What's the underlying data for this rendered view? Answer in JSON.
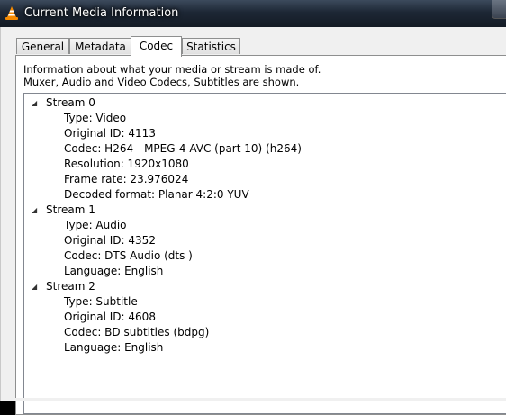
{
  "window": {
    "title": "Current Media Information",
    "icon": "vlc-cone-icon"
  },
  "tabs": [
    {
      "label": "General"
    },
    {
      "label": "Metadata"
    },
    {
      "label": "Codec",
      "active": true
    },
    {
      "label": "Statistics"
    }
  ],
  "description": {
    "line1": "Information about what your media or stream is made of.",
    "line2": "Muxer, Audio and Video Codecs, Subtitles are shown."
  },
  "streams": [
    {
      "label": "Stream 0",
      "attributes": [
        "Type: Video",
        "Original ID: 4113",
        "Codec: H264 - MPEG-4 AVC (part 10) (h264)",
        "Resolution: 1920x1080",
        "Frame rate: 23.976024",
        "Decoded format: Planar 4:2:0 YUV"
      ]
    },
    {
      "label": "Stream 1",
      "attributes": [
        "Type: Audio",
        "Original ID: 4352",
        "Codec: DTS Audio (dts )",
        "Language: English"
      ]
    },
    {
      "label": "Stream 2",
      "attributes": [
        "Type: Subtitle",
        "Original ID: 4608",
        "Codec: BD subtitles (bdpg)",
        "Language: English"
      ]
    }
  ]
}
